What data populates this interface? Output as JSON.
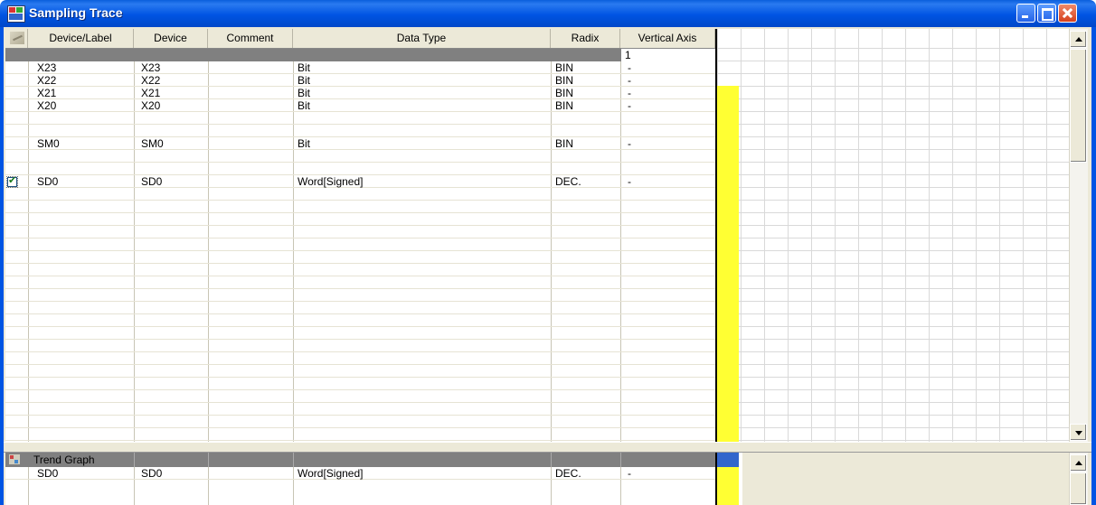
{
  "window": {
    "title": "Sampling Trace"
  },
  "columns": [
    "Device/Label",
    "Device",
    "Comment",
    "Data Type",
    "Radix",
    "Vertical Axis"
  ],
  "selected_row": {
    "vertical_axis": "1"
  },
  "rows": [
    {
      "checked": false,
      "label": "X23",
      "device": "X23",
      "comment": "",
      "data_type": "Bit",
      "radix": "BIN",
      "vertical_axis": "-"
    },
    {
      "checked": false,
      "label": "X22",
      "device": "X22",
      "comment": "",
      "data_type": "Bit",
      "radix": "BIN",
      "vertical_axis": "-"
    },
    {
      "checked": false,
      "label": "X21",
      "device": "X21",
      "comment": "",
      "data_type": "Bit",
      "radix": "BIN",
      "vertical_axis": "-"
    },
    {
      "checked": false,
      "label": "X20",
      "device": "X20",
      "comment": "",
      "data_type": "Bit",
      "radix": "BIN",
      "vertical_axis": "-"
    },
    {
      "checked": false,
      "label": "SM0",
      "device": "SM0",
      "comment": "",
      "data_type": "Bit",
      "radix": "BIN",
      "vertical_axis": "-"
    },
    {
      "checked": true,
      "label": "SD0",
      "device": "SD0",
      "comment": "",
      "data_type": "Word[Signed]",
      "radix": "DEC.",
      "vertical_axis": "-"
    }
  ],
  "trend": {
    "header_label": "Trend Graph",
    "rows": [
      {
        "label": "SD0",
        "device": "SD0",
        "comment": "",
        "data_type": "Word[Signed]",
        "radix": "DEC.",
        "vertical_axis": "-"
      }
    ]
  },
  "colors": {
    "title_bar": "#0054e3",
    "signal": "#ffff33",
    "selection": "#808080",
    "trend_marker": "#3366cc"
  }
}
